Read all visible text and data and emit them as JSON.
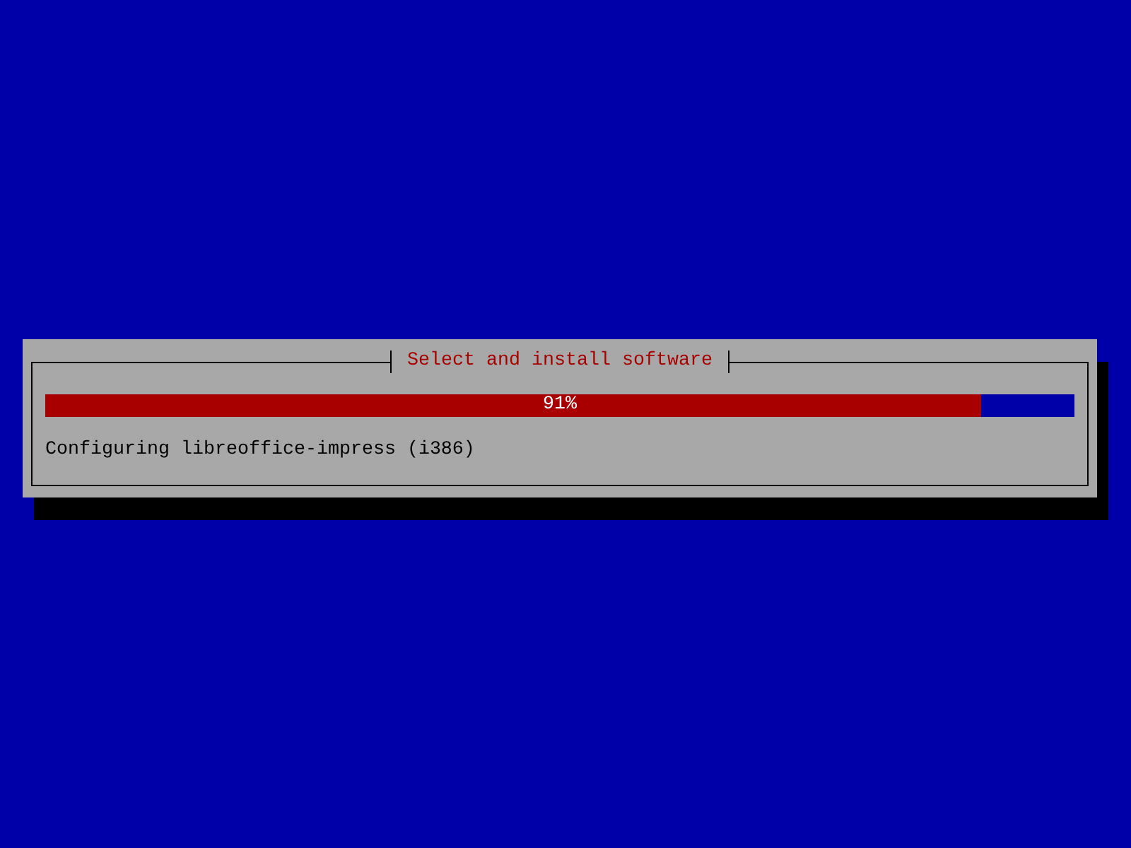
{
  "dialog": {
    "title": "Select and install software",
    "progress": {
      "level": 0.91,
      "reading": "91%"
    },
    "status": "Configuring libreoffice-impress (i386)"
  }
}
